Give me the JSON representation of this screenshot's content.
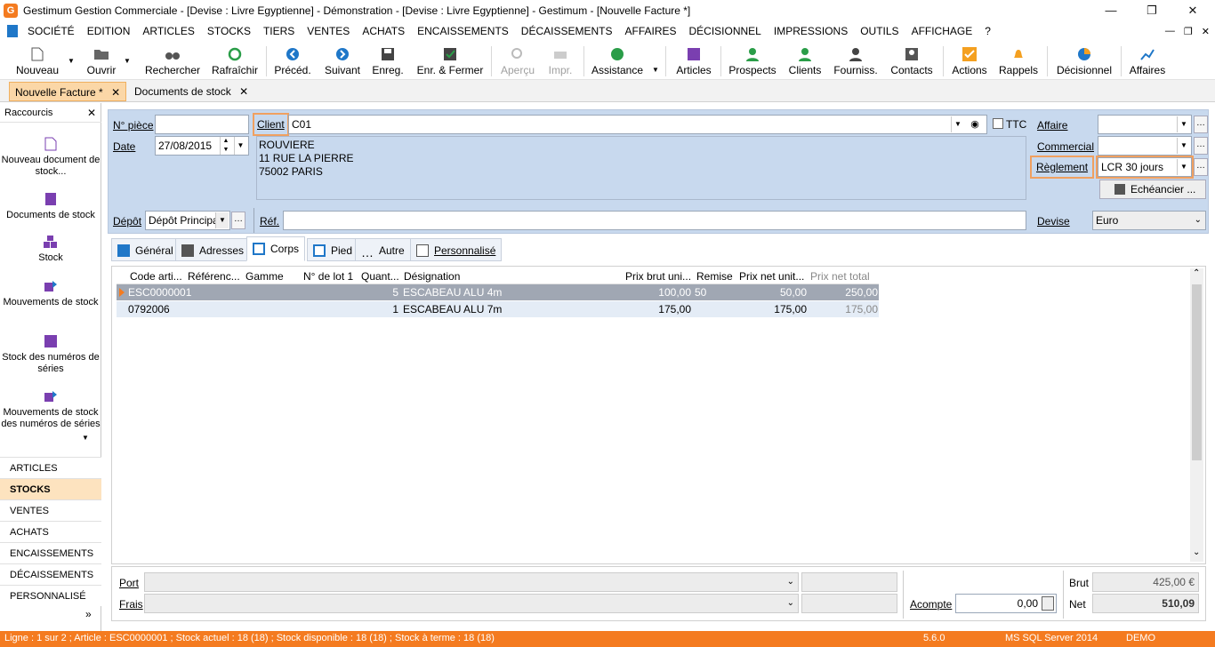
{
  "window": {
    "title": "Gestimum Gestion Commerciale - [Devise : Livre Egyptienne] - Démonstration - [Devise : Livre Egyptienne] - Gestimum - [Nouvelle Facture *]",
    "logo_letter": "G"
  },
  "menu": [
    "SOCIÉTÉ",
    "EDITION",
    "ARTICLES",
    "STOCKS",
    "TIERS",
    "VENTES",
    "ACHATS",
    "ENCAISSEMENTS",
    "DÉCAISSEMENTS",
    "AFFAIRES",
    "DÉCISIONNEL",
    "IMPRESSIONS",
    "OUTILS",
    "AFFICHAGE",
    "?"
  ],
  "toolbar": {
    "nouveau": "Nouveau",
    "ouvrir": "Ouvrir",
    "rechercher": "Rechercher",
    "rafraichir": "Rafraîchir",
    "preced": "Précéd.",
    "suivant": "Suivant",
    "enreg": "Enreg.",
    "enr_fermer": "Enr. & Fermer",
    "apercu": "Aperçu",
    "impr": "Impr.",
    "assistance": "Assistance",
    "articles": "Articles",
    "prospects": "Prospects",
    "clients": "Clients",
    "fourniss": "Fourniss.",
    "contacts": "Contacts",
    "actions": "Actions",
    "rappels": "Rappels",
    "decisionnel": "Décisionnel",
    "affaires": "Affaires"
  },
  "colors": {
    "accent": "#f47b20",
    "form_bg": "#c8d9ee",
    "selected_row": "#a0a7b3",
    "blue_icon": "#1f77c8",
    "green_icon": "#2a9d48",
    "purple_icon": "#7a3fb0"
  },
  "doc_tabs": [
    "Nouvelle Facture *",
    "Documents de stock"
  ],
  "sidebar": {
    "title": "Raccourcis",
    "items": [
      "Nouveau document de stock...",
      "Documents de stock",
      "Stock",
      "Mouvements de stock",
      "Stock des numéros de séries",
      "Mouvements de stock des numéros de séries"
    ],
    "modules": [
      "ARTICLES",
      "STOCKS",
      "VENTES",
      "ACHATS",
      "ENCAISSEMENTS",
      "DÉCAISSEMENTS",
      "PERSONNALISÉ"
    ],
    "more": "»"
  },
  "form": {
    "n_piece_label": "N° pièce",
    "n_piece_value": "",
    "date_label": "Date",
    "date_value": "27/08/2015",
    "client_label": "Client",
    "client_value": "C01",
    "address_lines": [
      "ROUVIERE",
      "11 RUE LA PIERRE",
      "75002 PARIS"
    ],
    "ttc_label": "TTC",
    "affaire_label": "Affaire",
    "affaire_value": "",
    "commercial_label": "Commercial",
    "commercial_value": "",
    "reglement_label": "Règlement",
    "reglement_value": "LCR 30 jours",
    "echeancier_label": "Echéancier ...",
    "depot_label": "Dépôt",
    "depot_value": "Dépôt Principal",
    "ref_label": "Réf.",
    "ref_value": "",
    "devise_label": "Devise",
    "devise_value": "Euro"
  },
  "inner_tabs": [
    "Général",
    "Adresses",
    "Corps",
    "Pied",
    "Autre",
    "Personnalisé"
  ],
  "grid": {
    "headers": [
      "Code arti...",
      "Référenc...",
      "Gamme",
      "N° de lot 1",
      "Quant...",
      "Désignation",
      "Prix brut uni...",
      "Remise",
      "Prix net unit...",
      "Prix net total"
    ],
    "rows": [
      {
        "code": "ESC0000001",
        "ref": "",
        "gamme": "",
        "lot": "",
        "qty": "5",
        "designation": "ESCABEAU ALU 4m",
        "prix_brut": "100,00",
        "remise": "50",
        "prix_net": "50,00",
        "total": "250,00"
      },
      {
        "code": "0792006",
        "ref": "",
        "gamme": "",
        "lot": "",
        "qty": "1",
        "designation": "ESCABEAU ALU 7m",
        "prix_brut": "175,00",
        "remise": "",
        "prix_net": "175,00",
        "total": "175,00"
      }
    ]
  },
  "footer": {
    "port_label": "Port",
    "frais_label": "Frais",
    "acompte_label": "Acompte",
    "acompte_value": "0,00",
    "brut_label": "Brut",
    "brut_value": "425,00 €",
    "net_label": "Net",
    "net_value": "510,09"
  },
  "status": {
    "info": "Ligne : 1 sur 2 ; Article : ESC0000001 ; Stock actuel : 18 (18) ; Stock disponible : 18 (18) ; Stock à terme : 18 (18)",
    "version": "5.6.0",
    "db": "MS SQL Server 2014",
    "mode": "DEMO"
  }
}
